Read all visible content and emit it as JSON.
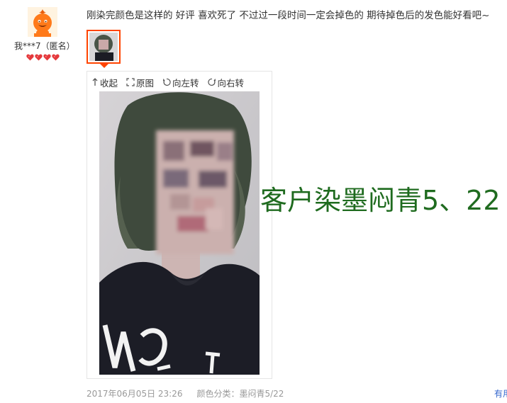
{
  "reviewer": {
    "name": "我***7（匿名）",
    "avatar_icon": "orange-mascot-avatar",
    "level_icon": "red-heart-icon",
    "level_count": 4,
    "level_color": "#e4393c"
  },
  "review": {
    "text": "刚染完颜色是这样的 好评 喜欢死了 不过过一段时间一定会掉色的 期待掉色后的发色能好看吧~"
  },
  "toolbar": {
    "collapse_label": "收起",
    "original_label": "原图",
    "rotate_left_label": "向左转",
    "rotate_right_label": "向右转"
  },
  "overlay": {
    "text": "客户染墨闷青5、22",
    "color": "#1f6b1f"
  },
  "meta": {
    "date": "2017年06月05日 23:26",
    "sku": "颜色分类：墨闷青5/22"
  },
  "more_link": "有用",
  "colors": {
    "accent": "#ff4400",
    "link": "#3366cc",
    "muted": "#999999"
  }
}
